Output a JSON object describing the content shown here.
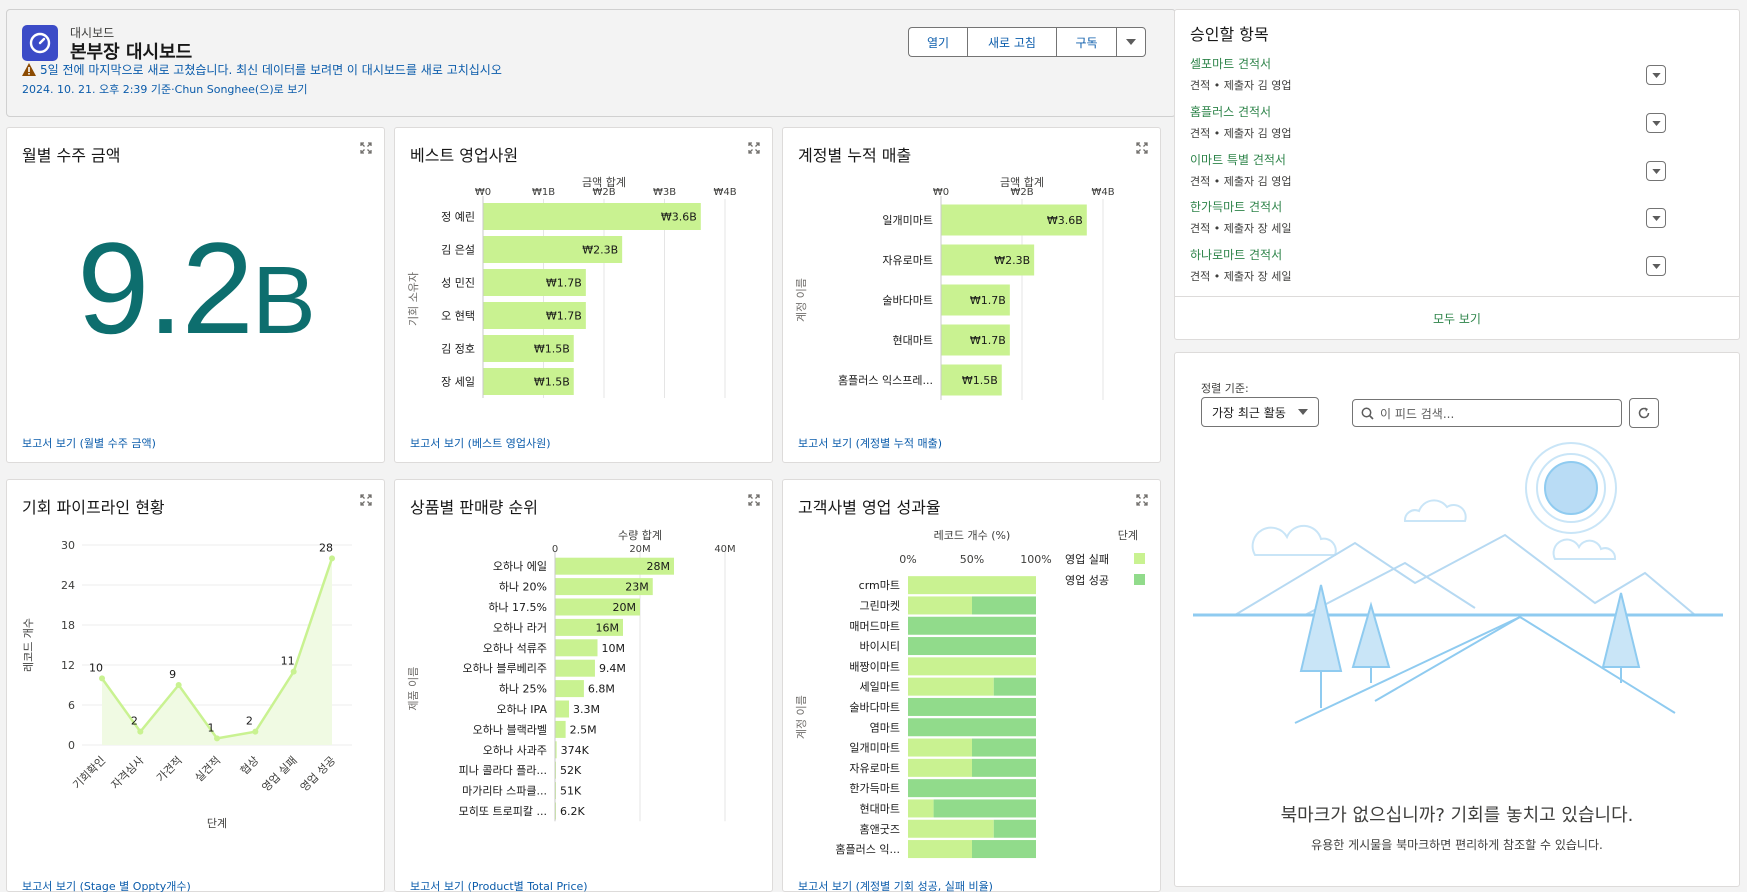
{
  "header": {
    "subtitle": "대시보드",
    "title": "본부장 대시보드",
    "warning": "5일 전에 마지막으로 새로 고쳤습니다. 최신 데이터를 보려면 이 대시보드를 새로 고치십시오",
    "as_of": "2024. 10. 21. 오후 2:39 기준·Chun Songhee(으)로 보기",
    "buttons": {
      "open": "열기",
      "refresh": "새로 고침",
      "subscribe": "구독"
    }
  },
  "widgets": {
    "monthly": {
      "title": "월별 수주 금액",
      "value": "9.2",
      "suffix": "B",
      "footer": "보고서 보기 (월별 수주 금액)"
    },
    "best": {
      "title": "베스트 영업사원",
      "footer": "보고서 보기 (베스트 영업사원)"
    },
    "account": {
      "title": "계정별 누적 매출",
      "footer": "보고서 보기 (계정별 누적 매출)"
    },
    "pipeline": {
      "title": "기회 파이프라인 현황",
      "footer": "보고서 보기 (Stage 별 Oppty개수)"
    },
    "product": {
      "title": "상품별 판매량 순위",
      "footer": "보고서 보기 (Product별 Total Price)"
    },
    "customer": {
      "title": "고객사별 영업 성과율",
      "footer": "보고서 보기 (계정별 기회 성공, 실패 비율)"
    }
  },
  "approvals": {
    "title": "승인할 항목",
    "items": [
      {
        "name": "셀포마트 견적서",
        "meta": "견적 • 제출자 김 영업"
      },
      {
        "name": "홈플러스 견적서",
        "meta": "견적 • 제출자 김 영업"
      },
      {
        "name": "이마트 특별 견적서",
        "meta": "견적 • 제출자 김 영업"
      },
      {
        "name": "한가득마트 견적서",
        "meta": "견적 • 제출자 장 세일"
      },
      {
        "name": "하나로마트 견적서",
        "meta": "견적 • 제출자 장 세일"
      }
    ],
    "view_all": "모두 보기"
  },
  "feed": {
    "sort_label": "정렬 기준:",
    "sort_value": "가장 최근 활동",
    "search_placeholder": "이 피드 검색...",
    "empty_title": "북마크가 없으십니까? 기회를 놓치고 있습니다.",
    "empty_sub": "유용한 게시물을 북마크하면 편리하게 참조할 수 있습니다."
  },
  "colors": {
    "bar": "#c9f291",
    "success": "#91db8b",
    "fail": "#c9f291",
    "bignum": "#0d6e6e",
    "link": "#0b5cab",
    "green_link": "#2e844a",
    "line": "#c9f291"
  },
  "icons": {
    "expand": "expand-icon",
    "warning": "warning-icon",
    "dashboard": "dashboard-icon",
    "search": "search-icon",
    "refresh": "refresh-icon",
    "dropdown": "chevron-down-icon"
  },
  "chart_data": [
    {
      "id": "best",
      "type": "bar",
      "orientation": "horizontal",
      "xlabel": "금액 합계",
      "ylabel": "기회 소유자",
      "xticks": [
        "₩0",
        "₩1B",
        "₩2B",
        "₩3B",
        "₩4B"
      ],
      "xlim": [
        0,
        4
      ],
      "categories": [
        "정 예린",
        "김 은설",
        "성 민진",
        "오 현택",
        "김 정호",
        "장 세일"
      ],
      "values": [
        3.6,
        2.3,
        1.7,
        1.7,
        1.5,
        1.5
      ],
      "labels": [
        "₩3.6B",
        "₩2.3B",
        "₩1.7B",
        "₩1.7B",
        "₩1.5B",
        "₩1.5B"
      ]
    },
    {
      "id": "account",
      "type": "bar",
      "orientation": "horizontal",
      "xlabel": "금액 합계",
      "ylabel": "계정 이름",
      "xticks": [
        "₩0",
        "₩2B",
        "₩4B"
      ],
      "xlim": [
        0,
        4
      ],
      "categories": [
        "일개미마트",
        "자유로마트",
        "술바다마트",
        "현대마트",
        "홈플러스 익스프레..."
      ],
      "values": [
        3.6,
        2.3,
        1.7,
        1.7,
        1.5
      ],
      "labels": [
        "₩3.6B",
        "₩2.3B",
        "₩1.7B",
        "₩1.7B",
        "₩1.5B"
      ]
    },
    {
      "id": "pipeline",
      "type": "line",
      "xlabel": "단계",
      "ylabel": "레코드 개수",
      "yticks": [
        0,
        6,
        12,
        18,
        24,
        30
      ],
      "ylim": [
        0,
        30
      ],
      "categories": [
        "기회확인",
        "자격심사",
        "가견적",
        "실견적",
        "협상",
        "영업 실패",
        "영업 성공"
      ],
      "values": [
        10,
        2,
        9,
        1,
        2,
        11,
        28
      ]
    },
    {
      "id": "product",
      "type": "bar",
      "orientation": "horizontal",
      "xlabel": "수량 합계",
      "ylabel": "제품 이름",
      "xticks": [
        "0",
        "20M",
        "40M"
      ],
      "xlim": [
        0,
        40
      ],
      "categories": [
        "오하나 에일",
        "하나 20%",
        "하나 17.5%",
        "오하나 라거",
        "오하나 석류주",
        "오하나 블루베리주",
        "하나 25%",
        "오하나 IPA",
        "오하나 블랙라벨",
        "오하나 사과주",
        "피나 콜라다 플라...",
        "마가리타 스파클...",
        "모히또 트로피칼 ..."
      ],
      "values": [
        28,
        23,
        20,
        16,
        10,
        9.4,
        6.8,
        3.3,
        2.5,
        0.374,
        0.052,
        0.051,
        0.0062
      ],
      "labels": [
        "28M",
        "23M",
        "20M",
        "16M",
        "10M",
        "9.4M",
        "6.8M",
        "3.3M",
        "2.5M",
        "374K",
        "52K",
        "51K",
        "6.2K"
      ]
    },
    {
      "id": "customer",
      "type": "bar",
      "orientation": "horizontal",
      "stacked": "percent",
      "xlabel": "레코드 개수 (%)",
      "ylabel": "계정 이름",
      "xticks": [
        "0%",
        "50%",
        "100%"
      ],
      "legend_title": "단계",
      "categories": [
        "crm마트",
        "그린마켓",
        "매머드마트",
        "바이시티",
        "배짱이마트",
        "세일마트",
        "술바다마트",
        "염마트",
        "일개미마트",
        "자유로마트",
        "한가득마트",
        "현대마트",
        "홈앤굿즈",
        "홈플러스 익..."
      ],
      "series": [
        {
          "name": "영업 실패",
          "values": [
            100,
            50,
            0,
            0,
            100,
            67,
            0,
            0,
            50,
            50,
            0,
            20,
            67,
            50
          ]
        },
        {
          "name": "영업 성공",
          "values": [
            0,
            50,
            100,
            100,
            0,
            33,
            100,
            100,
            50,
            50,
            100,
            80,
            33,
            50
          ]
        }
      ]
    }
  ]
}
